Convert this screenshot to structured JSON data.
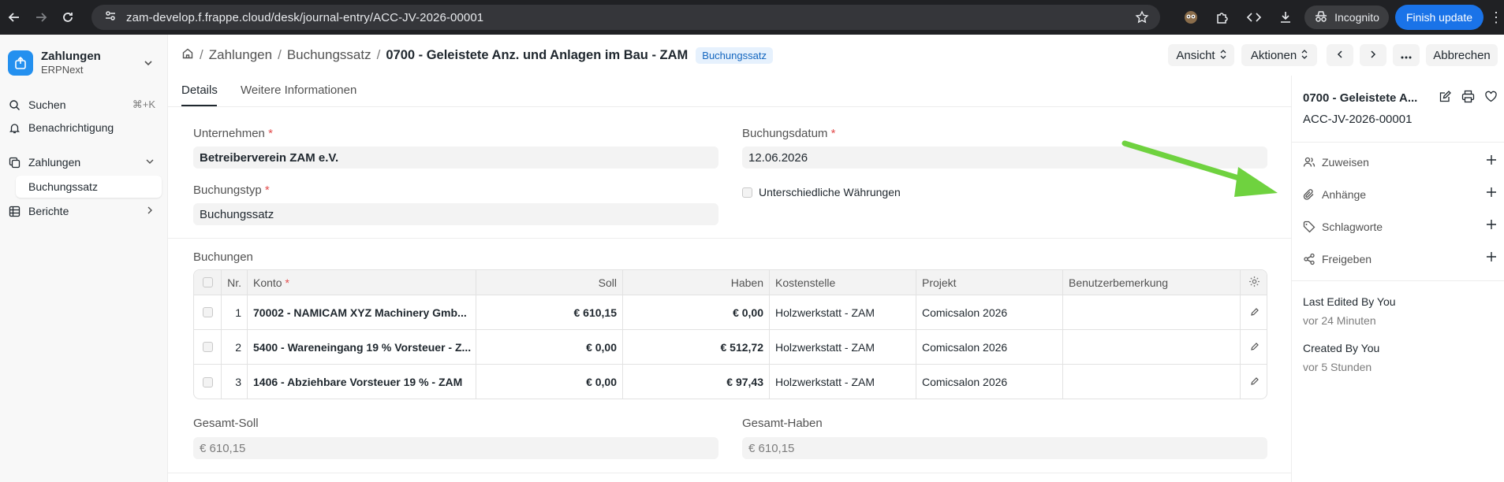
{
  "browser": {
    "url": "zam-develop.f.frappe.cloud/desk/journal-entry/ACC-JV-2026-00001",
    "incognito_label": "Incognito",
    "finish_update_label": "Finish update"
  },
  "sidebar": {
    "app_name": "Zahlungen",
    "app_sub": "ERPNext",
    "search_label": "Suchen",
    "search_shortcut": "⌘+K",
    "notifications_label": "Benachrichtigung",
    "group_label": "Zahlungen",
    "active_item": "Buchungssatz",
    "reports_label": "Berichte"
  },
  "header": {
    "crumb1": "Zahlungen",
    "crumb2": "Buchungssatz",
    "title": "0700 - Geleistete Anz. und Anlagen im Bau - ZAM",
    "badge": "Buchungssatz",
    "view_label": "Ansicht",
    "actions_label": "Aktionen",
    "cancel_label": "Abbrechen"
  },
  "tabs": [
    "Details",
    "Weitere Informationen"
  ],
  "form": {
    "company_label": "Unternehmen",
    "company_value": "Betreiberverein ZAM e.V.",
    "date_label": "Buchungsdatum",
    "date_value": "12.06.2026",
    "type_label": "Buchungstyp",
    "type_value": "Buchungssatz",
    "multi_currency_label": "Unterschiedliche Währungen",
    "entries_label": "Buchungen",
    "total_debit_label": "Gesamt-Soll",
    "total_debit_value": "€ 610,15",
    "total_credit_label": "Gesamt-Haben",
    "total_credit_value": "€ 610,15"
  },
  "table": {
    "headers": {
      "nr": "Nr.",
      "account": "Konto",
      "debit": "Soll",
      "credit": "Haben",
      "cost_center": "Kostenstelle",
      "project": "Projekt",
      "remark": "Benutzerbemerkung"
    },
    "rows": [
      {
        "nr": "1",
        "account": "70002 - NAMICAM XYZ Machinery Gmb...",
        "debit": "€ 610,15",
        "credit": "€ 0,00",
        "cost_center": "Holzwerkstatt - ZAM",
        "project": "Comicsalon 2026",
        "remark": ""
      },
      {
        "nr": "2",
        "account": "5400 - Wareneingang 19 % Vorsteuer - Z...",
        "debit": "€ 0,00",
        "credit": "€ 512,72",
        "cost_center": "Holzwerkstatt - ZAM",
        "project": "Comicsalon 2026",
        "remark": ""
      },
      {
        "nr": "3",
        "account": "1406 - Abziehbare Vorsteuer 19 % - ZAM",
        "debit": "€ 0,00",
        "credit": "€ 97,43",
        "cost_center": "Holzwerkstatt - ZAM",
        "project": "Comicsalon 2026",
        "remark": ""
      }
    ]
  },
  "right_panel": {
    "title": "0700 - Geleistete A...",
    "doc_id": "ACC-JV-2026-00001",
    "assign_label": "Zuweisen",
    "attachments_label": "Anhänge",
    "tags_label": "Schlagworte",
    "share_label": "Freigeben",
    "last_edited": "Last Edited By You",
    "last_edited_ago": "vor 24 Minuten",
    "created": "Created By You",
    "created_ago": "vor 5 Stunden"
  },
  "colors": {
    "accent": "#2490ef",
    "arrow": "#6fd23f"
  }
}
